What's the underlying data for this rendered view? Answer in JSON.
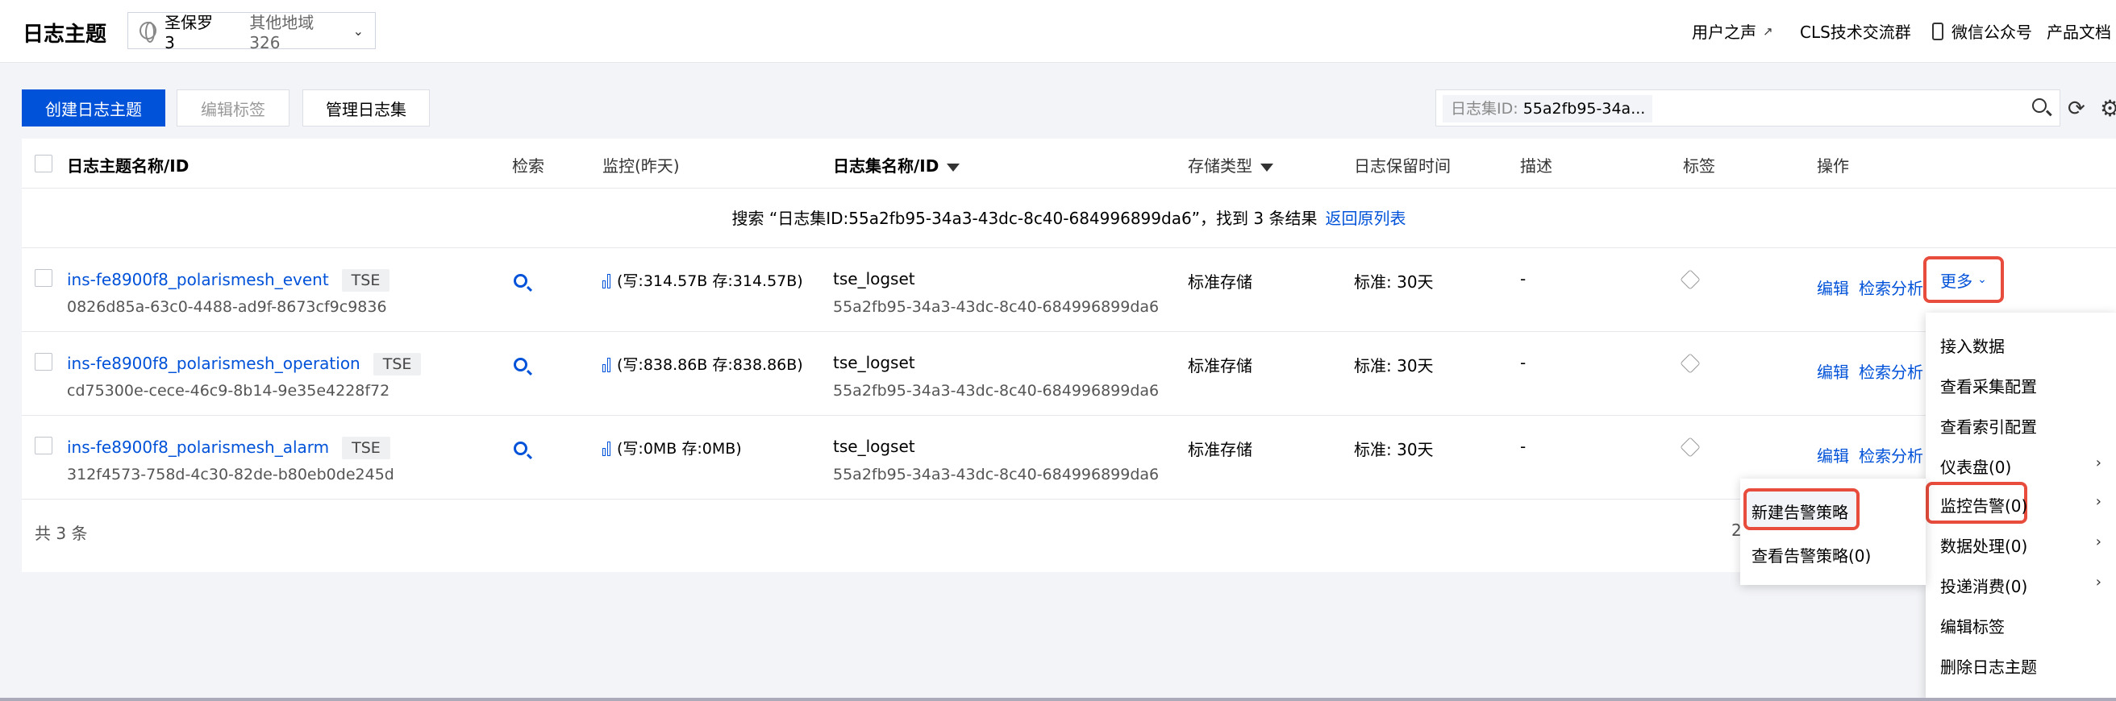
{
  "header": {
    "title": "日志主题",
    "region_current": "圣保罗 3",
    "region_other": "其他地域 326",
    "user_voice": "用户之声",
    "cls_group": "CLS技术交流群",
    "wechat": "微信公众号",
    "docs": "产品文档"
  },
  "toolbar": {
    "create_label": "创建日志主题",
    "edit_tags_label": "编辑标签",
    "manage_logset_label": "管理日志集",
    "search_tag_key": "日志集ID:",
    "search_tag_value": "55a2fb95-34a..."
  },
  "table": {
    "headers": {
      "name": "日志主题名称/ID",
      "search": "检索",
      "monitor": "监控(昨天)",
      "logset": "日志集名称/ID",
      "storage": "存储类型",
      "retention": "日志保留时间",
      "desc": "描述",
      "tags": "标签",
      "ops": "操作"
    },
    "info_text": "搜索 “日志集ID:55a2fb95-34a3-43dc-8c40-684996899da6”，找到 3 条结果",
    "info_link": "返回原列表",
    "rows": [
      {
        "name": "ins-fe8900f8_polarismesh_event",
        "badge": "TSE",
        "id": "0826d85a-63c0-4488-ad9f-8673cf9c9836",
        "monitor": "(写:314.57B   存:314.57B)",
        "logset": "tse_logset",
        "logset_id": "55a2fb95-34a3-43dc-8c40-684996899da6",
        "storage": "标准存储",
        "retention": "标准: 30天",
        "desc": "-",
        "op_edit": "编辑",
        "op_search": "检索分析"
      },
      {
        "name": "ins-fe8900f8_polarismesh_operation",
        "badge": "TSE",
        "id": "cd75300e-cece-46c9-8b14-9e35e4228f72",
        "monitor": "(写:838.86B   存:838.86B)",
        "logset": "tse_logset",
        "logset_id": "55a2fb95-34a3-43dc-8c40-684996899da6",
        "storage": "标准存储",
        "retention": "标准: 30天",
        "desc": "-",
        "op_edit": "编辑",
        "op_search": "检索分析"
      },
      {
        "name": "ins-fe8900f8_polarismesh_alarm",
        "badge": "TSE",
        "id": "312f4573-758d-4c30-82de-b80eb0de245d",
        "monitor": "(写:0MB   存:0MB)",
        "logset": "tse_logset",
        "logset_id": "55a2fb95-34a3-43dc-8c40-684996899da6",
        "storage": "标准存储",
        "retention": "标准: 30天",
        "desc": "-",
        "op_edit": "编辑",
        "op_search": "检索分析"
      }
    ],
    "more_label": "更多",
    "footer_count": "共 3 条",
    "footer_page": "2"
  },
  "menu": {
    "items": [
      "接入数据",
      "查看采集配置",
      "查看索引配置",
      "仪表盘(0)",
      "监控告警(0)",
      "数据处理(0)",
      "投递消费(0)",
      "编辑标签",
      "删除日志主题"
    ],
    "sub_items": [
      "新建告警策略",
      "查看告警策略(0)"
    ]
  },
  "colors": {
    "primary": "#0052d9",
    "highlight": "#e74c3c"
  }
}
